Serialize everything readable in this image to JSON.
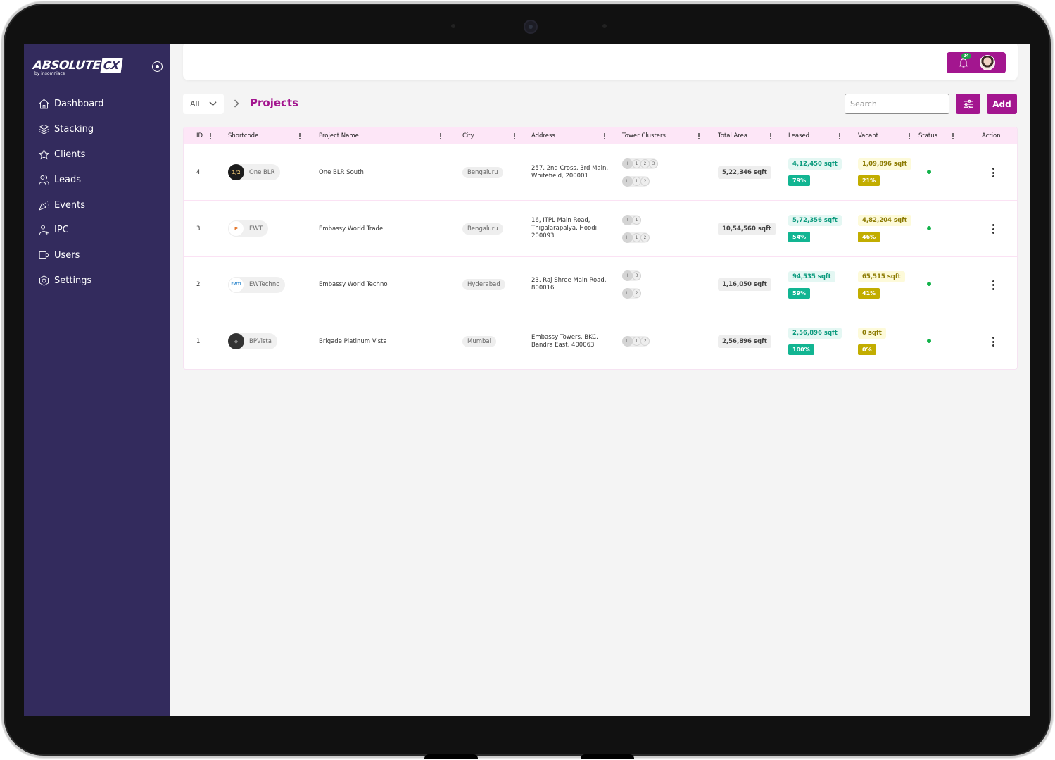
{
  "brand": {
    "name": "ABSOLUTE",
    "suffix": "CX",
    "tagline": "by insomniacs"
  },
  "sidebar": {
    "items": [
      {
        "label": "Dashboard",
        "icon": "home-icon"
      },
      {
        "label": "Stacking",
        "icon": "layers-icon"
      },
      {
        "label": "Clients",
        "icon": "star-icon"
      },
      {
        "label": "Leads",
        "icon": "users-icon"
      },
      {
        "label": "Events",
        "icon": "party-icon"
      },
      {
        "label": "IPC",
        "icon": "user-plus-icon"
      },
      {
        "label": "Users",
        "icon": "mug-icon"
      },
      {
        "label": "Settings",
        "icon": "settings-icon"
      }
    ]
  },
  "header": {
    "notification_count": "24"
  },
  "toolbar": {
    "filter_value": "All",
    "page_title": "Projects",
    "search_placeholder": "Search",
    "add_label": "Add"
  },
  "table": {
    "columns": [
      "ID",
      "Shortcode",
      "Project Name",
      "City",
      "Address",
      "Tower Clusters",
      "Total Area",
      "Leased",
      "Vacant",
      "Status",
      "Action"
    ],
    "rows": [
      {
        "id": "4",
        "shortcode": "One BLR",
        "logo": "1/2",
        "project_name": "One BLR South",
        "city": "Bengaluru",
        "address": "257, 2nd Cross, 3rd Main, Whitefield, 200001",
        "clusters": [
          {
            "roman": "I",
            "towers": [
              "1",
              "2",
              "3"
            ]
          },
          {
            "roman": "II",
            "towers": [
              "1",
              "2"
            ]
          }
        ],
        "total_area": "5,22,346 sqft",
        "leased": "4,12,450 sqft",
        "leased_pct": "79%",
        "vacant": "1,09,896 sqft",
        "vacant_pct": "21%",
        "status": "active"
      },
      {
        "id": "3",
        "shortcode": "EWT",
        "logo": "P",
        "project_name": "Embassy World Trade",
        "city": "Bengaluru",
        "address": "16, ITPL Main Road, Thigalarapalya, Hoodi, 200093",
        "clusters": [
          {
            "roman": "I",
            "towers": [
              "1"
            ]
          },
          {
            "roman": "II",
            "towers": [
              "1",
              "2"
            ]
          }
        ],
        "total_area": "10,54,560 sqft",
        "leased": "5,72,356 sqft",
        "leased_pct": "54%",
        "vacant": "4,82,204 sqft",
        "vacant_pct": "46%",
        "status": "active"
      },
      {
        "id": "2",
        "shortcode": "EWTechno",
        "logo": "EWTI",
        "project_name": "Embassy World Techno",
        "city": "Hyderabad",
        "address": "23, Raj Shree Main Road, 800016",
        "clusters": [
          {
            "roman": "I",
            "towers": [
              "3"
            ]
          },
          {
            "roman": "II",
            "towers": [
              "2"
            ]
          }
        ],
        "total_area": "1,16,050 sqft",
        "leased": "94,535 sqft",
        "leased_pct": "59%",
        "vacant": "65,515 sqft",
        "vacant_pct": "41%",
        "status": "active"
      },
      {
        "id": "1",
        "shortcode": "BPVista",
        "logo": "◈",
        "project_name": "Brigade Platinum Vista",
        "city": "Mumbai",
        "address": "Embassy Towers, BKC, Bandra East, 400063",
        "clusters": [
          {
            "roman": "II",
            "towers": [
              "1",
              "2"
            ]
          }
        ],
        "total_area": "2,56,896 sqft",
        "leased": "2,56,896 sqft",
        "leased_pct": "100%",
        "vacant": "0 sqft",
        "vacant_pct": "0%",
        "status": "active"
      }
    ]
  },
  "colors": {
    "brand": "#a3168f",
    "sidebar": "#332b5d",
    "leased": "#12b592",
    "vacant": "#c2ad00",
    "status_active": "#12b24a"
  }
}
